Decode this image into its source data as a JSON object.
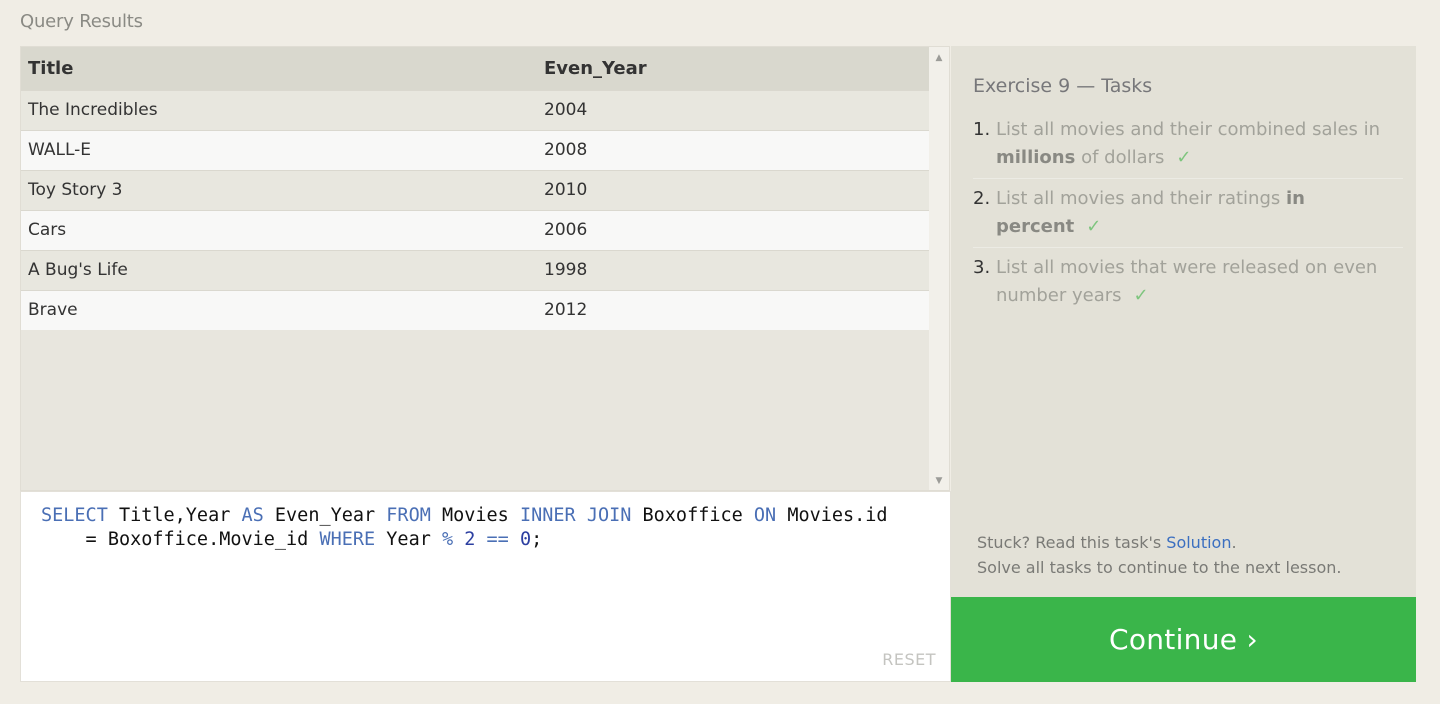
{
  "results": {
    "title": "Query Results",
    "columns": [
      "Title",
      "Even_Year"
    ],
    "rows": [
      [
        "The Incredibles",
        "2004"
      ],
      [
        "WALL-E",
        "2008"
      ],
      [
        "Toy Story 3",
        "2010"
      ],
      [
        "Cars",
        "2006"
      ],
      [
        "A Bug's Life",
        "1998"
      ],
      [
        "Brave",
        "2012"
      ]
    ]
  },
  "editor": {
    "line1": [
      {
        "t": "SELECT",
        "k": "kw"
      },
      {
        "t": " Title,Year ",
        "k": ""
      },
      {
        "t": "AS",
        "k": "kw"
      },
      {
        "t": " Even_Year ",
        "k": ""
      },
      {
        "t": "FROM",
        "k": "kw"
      },
      {
        "t": " Movies ",
        "k": ""
      },
      {
        "t": "INNER",
        "k": "kw"
      },
      {
        "t": " ",
        "k": ""
      },
      {
        "t": "JOIN",
        "k": "kw"
      },
      {
        "t": " Boxoffice ",
        "k": ""
      },
      {
        "t": "ON",
        "k": "kw"
      },
      {
        "t": " Movies.id",
        "k": ""
      }
    ],
    "line2": [
      {
        "t": "    = Boxoffice.Movie_id ",
        "k": ""
      },
      {
        "t": "WHERE",
        "k": "kw"
      },
      {
        "t": " Year ",
        "k": ""
      },
      {
        "t": "%",
        "k": "op"
      },
      {
        "t": " ",
        "k": ""
      },
      {
        "t": "2",
        "k": "num"
      },
      {
        "t": " ",
        "k": ""
      },
      {
        "t": "==",
        "k": "op"
      },
      {
        "t": " ",
        "k": ""
      },
      {
        "t": "0",
        "k": "num"
      },
      {
        "t": ";",
        "k": ""
      }
    ],
    "reset_label": "RESET"
  },
  "tasks": {
    "title": "Exercise 9 — Tasks",
    "items": [
      {
        "num": "1.",
        "parts": [
          {
            "t": "List all movies and their combined sales in ",
            "b": false
          },
          {
            "t": "millions",
            "b": true
          },
          {
            "t": " of dollars",
            "b": false
          }
        ],
        "check": "✓"
      },
      {
        "num": "2.",
        "parts": [
          {
            "t": "List all movies and their ratings ",
            "b": false
          },
          {
            "t": "in percent",
            "b": true
          }
        ],
        "check": "✓"
      },
      {
        "num": "3.",
        "parts": [
          {
            "t": "List all movies that were released on even number years",
            "b": false
          }
        ],
        "check": "✓"
      }
    ],
    "stuck_prefix": "Stuck? Read this task's ",
    "solution_link": "Solution",
    "stuck_suffix": ".",
    "continue_note": "Solve all tasks to continue to the next lesson."
  },
  "continue_button": "Continue ›",
  "colors": {
    "accent": "#3ab54a",
    "link": "#3b6fc0",
    "keyword": "#4a6fb5"
  },
  "icons": {
    "scroll_up": "triangle-up",
    "scroll_down": "triangle-down",
    "check": "checkmark"
  }
}
